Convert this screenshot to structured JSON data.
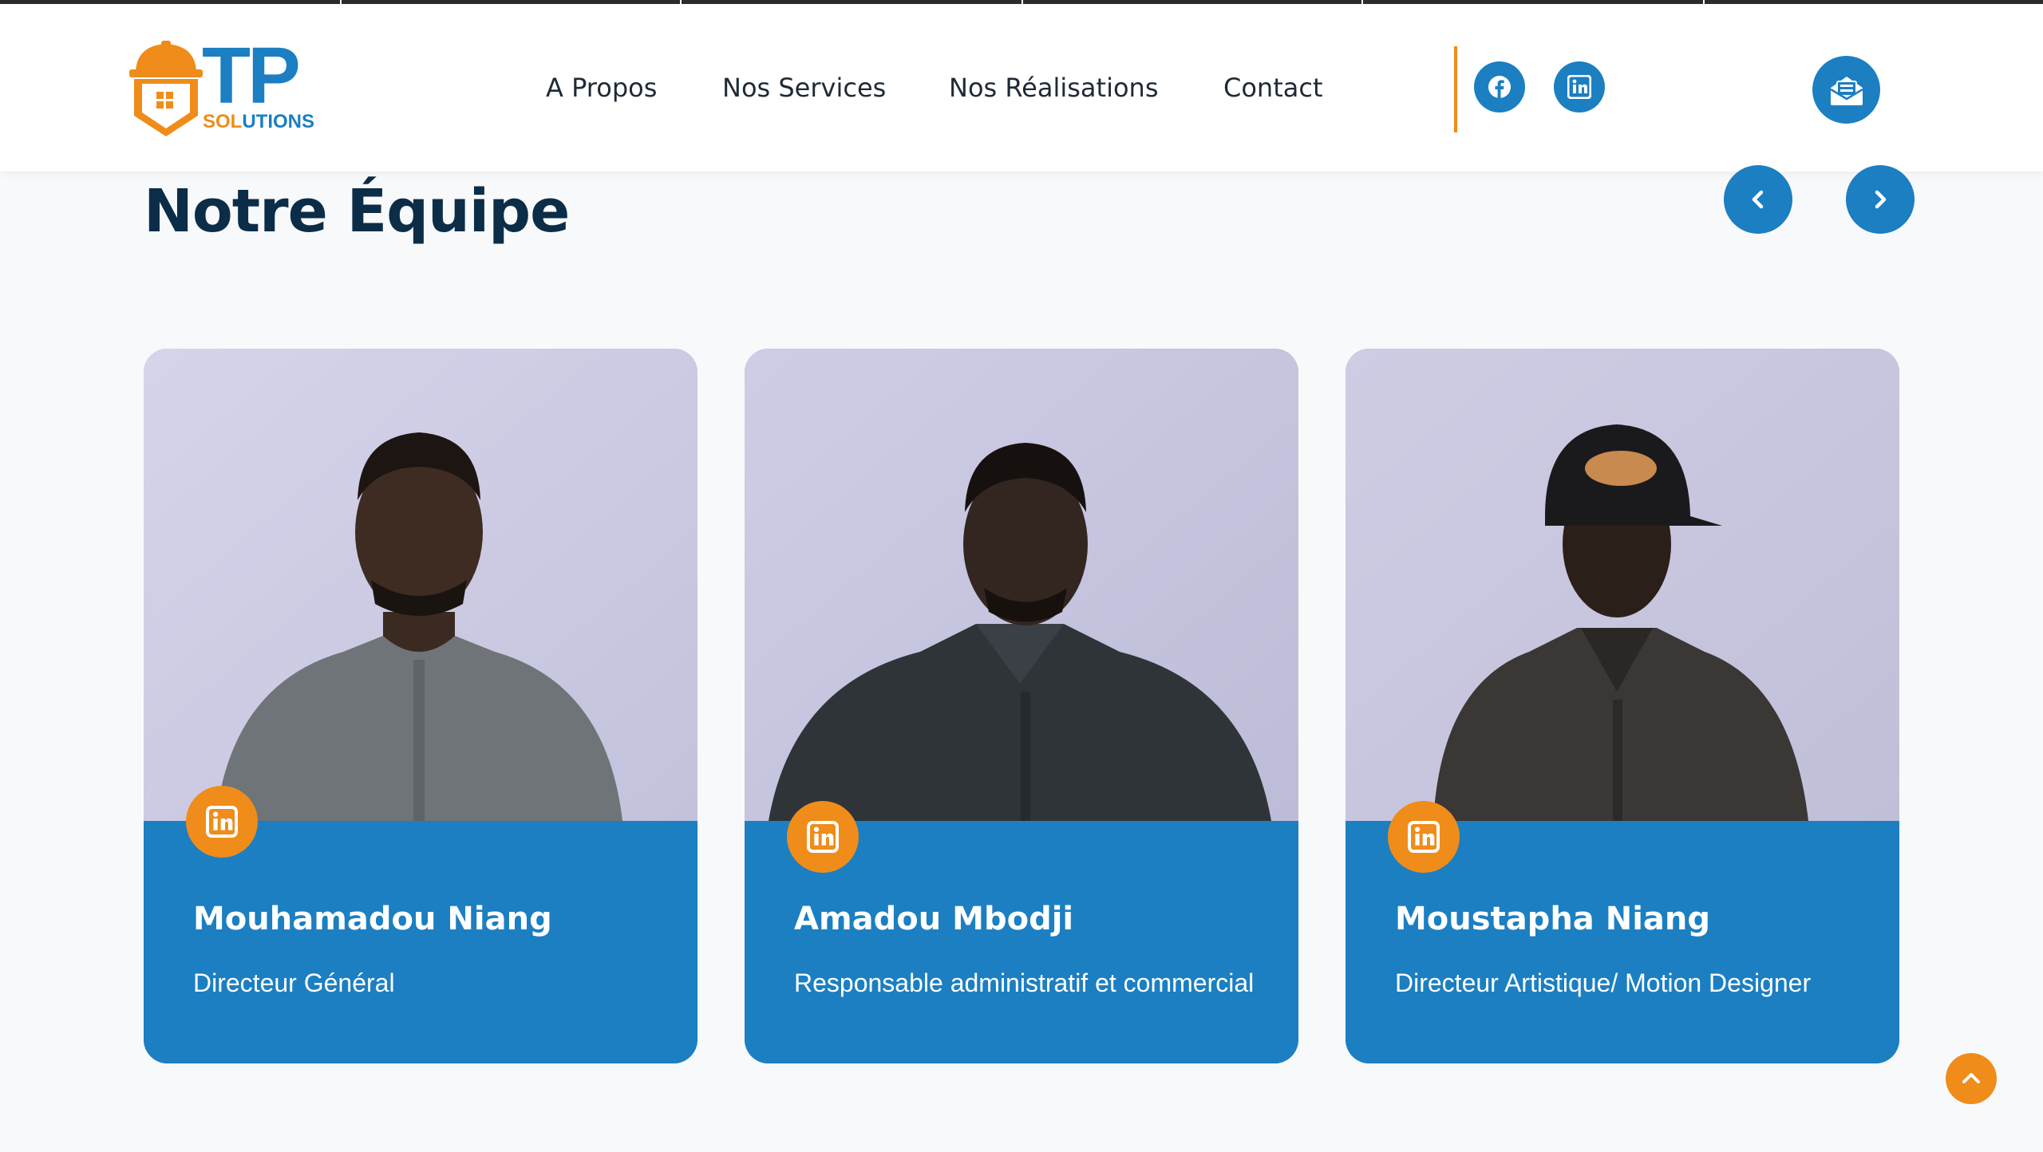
{
  "brand": {
    "logo_main": "TP",
    "logo_sub_orange": "SOL",
    "logo_sub_blue": "UTIONS",
    "primary_color": "#1b7fc2",
    "accent_color": "#f08c1a",
    "title_color": "#0c2d48"
  },
  "nav": {
    "items": [
      {
        "label": "A Propos"
      },
      {
        "label": "Nos Services"
      },
      {
        "label": "Nos Réalisations"
      },
      {
        "label": "Contact"
      }
    ],
    "social": [
      {
        "icon": "facebook-icon"
      },
      {
        "icon": "linkedin-icon"
      }
    ],
    "contact_icon": "mail-open-icon"
  },
  "team": {
    "title": "Notre Équipe",
    "prev_icon": "chevron-left-icon",
    "next_icon": "chevron-right-icon",
    "members": [
      {
        "name": "Mouhamadou Niang",
        "role": "Directeur Général",
        "icon": "linkedin-icon"
      },
      {
        "name": "Amadou Mbodji",
        "role": "Responsable administratif et commercial",
        "icon": "linkedin-icon"
      },
      {
        "name": "Moustapha Niang",
        "role": "Directeur Artistique/ Motion Designer",
        "icon": "linkedin-icon"
      }
    ]
  },
  "back_to_top_icon": "chevron-up-icon"
}
